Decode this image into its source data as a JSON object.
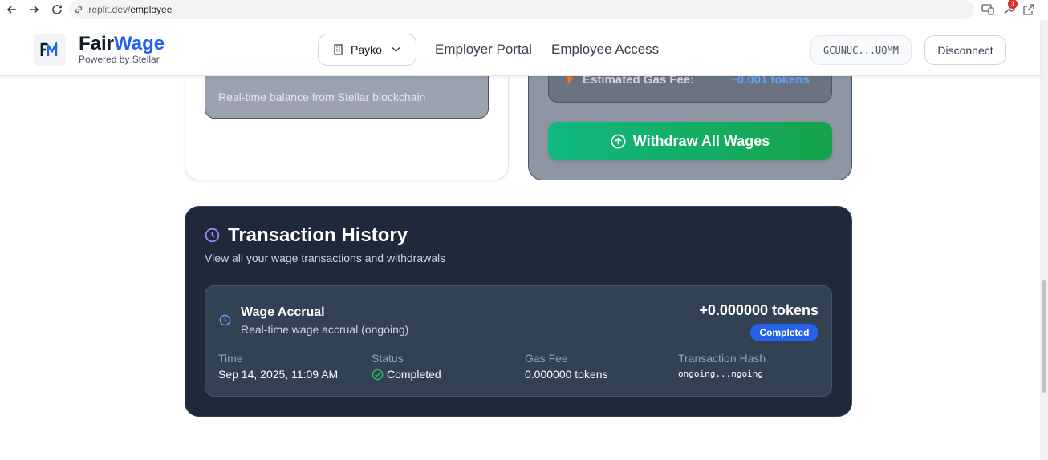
{
  "browser": {
    "url_host": ".replit.dev/",
    "url_path": "employee",
    "extension_badge": "3"
  },
  "header": {
    "brand_part1": "Fair",
    "brand_part2": "Wage",
    "tagline": "Powered by Stellar",
    "org_selected": "Payko",
    "nav": [
      "Employer Portal",
      "Employee Access"
    ],
    "wallet": "GCUNUC...UQMM",
    "disconnect_label": "Disconnect"
  },
  "balance_card": {
    "note": "Real-time balance from Stellar blockchain"
  },
  "withdraw_card": {
    "gas_label": "Estimated Gas Fee:",
    "gas_value": "~0.001 tokens",
    "withdraw_label": "Withdraw All Wages"
  },
  "history": {
    "title": "Transaction History",
    "subtitle": "View all your wage transactions and withdrawals",
    "items": [
      {
        "title": "Wage Accrual",
        "description": "Real-time wage accrual (ongoing)",
        "amount": "+0.000000 tokens",
        "badge": "Completed",
        "time_label": "Time",
        "time_value": "Sep 14, 2025, 11:09 AM",
        "status_label": "Status",
        "status_value": "Completed",
        "gas_label": "Gas Fee",
        "gas_value": "0.000000 tokens",
        "hash_label": "Transaction Hash",
        "hash_value": "ongoing...ngoing"
      }
    ]
  },
  "colors": {
    "brand_blue": "#2563eb",
    "success_green": "#10b981",
    "dark_card": "#1e293b"
  }
}
